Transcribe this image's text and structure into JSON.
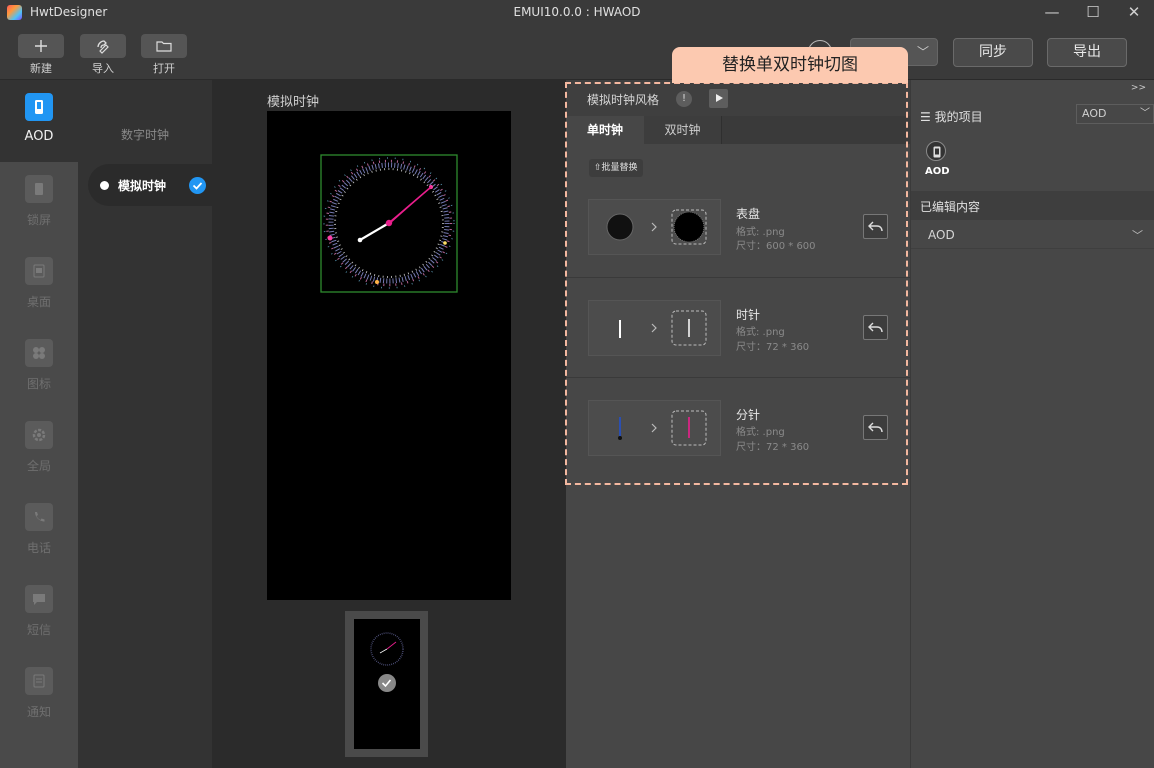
{
  "app": {
    "name": "HwtDesigner",
    "window_title": "EMUI10.0.0 : HWAOD"
  },
  "window_controls": {
    "minimize": "—",
    "maximize": "☐",
    "close": "✕"
  },
  "toolbar": {
    "buttons": [
      {
        "label": "新建",
        "icon": "plus-icon"
      },
      {
        "label": "导入",
        "icon": "import-icon"
      },
      {
        "label": "打开",
        "icon": "folder-icon"
      }
    ],
    "select_value": "",
    "sync_label": "同步",
    "export_label": "导出"
  },
  "left_nav": {
    "items": [
      {
        "label": "AOD",
        "icon": "phone-icon",
        "active": true
      },
      {
        "label": "锁屏",
        "icon": "lock-screen-icon"
      },
      {
        "label": "桌面",
        "icon": "desktop-icon"
      },
      {
        "label": "图标",
        "icon": "grid-icon"
      },
      {
        "label": "全局",
        "icon": "gear-icon"
      },
      {
        "label": "电话",
        "icon": "phone-call-icon"
      },
      {
        "label": "短信",
        "icon": "message-icon"
      },
      {
        "label": "通知",
        "icon": "notification-icon"
      }
    ]
  },
  "sub_nav": {
    "digital_clock": "数字时钟",
    "analog_clock": "模拟时钟"
  },
  "preview": {
    "label": "模拟时钟"
  },
  "props": {
    "title": "模拟时钟风格",
    "info": "!",
    "tabs": [
      "单时钟",
      "双时钟"
    ],
    "batch_replace": "批量替换",
    "items": [
      {
        "name": "表盘",
        "format": "格式: .png",
        "size": "尺寸：600 * 600"
      },
      {
        "name": "时针",
        "format": "格式: .png",
        "size": "尺寸：72 * 360"
      },
      {
        "name": "分针",
        "format": "格式: .png",
        "size": "尺寸：72 * 360"
      }
    ]
  },
  "annotation": {
    "label": "替换单双时钟切图"
  },
  "right_panel": {
    "expand": ">>",
    "my_projects": "我的项目",
    "project_select": "AOD",
    "project_item": "AOD",
    "edited_content": "已编辑内容",
    "edited_item": "AOD"
  },
  "colors": {
    "accent": "#2196f3",
    "annotation": "#fcc9b0",
    "clock_hand": "#e91e8c"
  }
}
